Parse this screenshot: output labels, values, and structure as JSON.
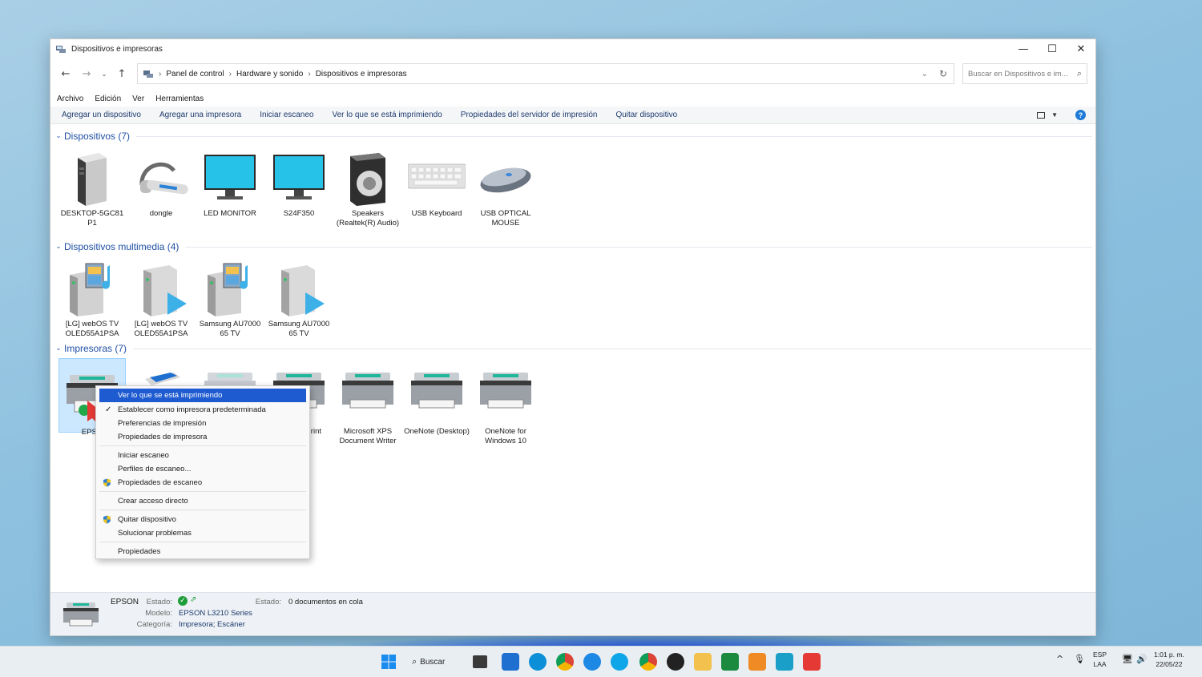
{
  "window": {
    "title": "Dispositivos e impresoras",
    "minimize": "—",
    "maximize": "☐",
    "close": "✕"
  },
  "address": {
    "crumbs": [
      "Panel de control",
      "Hardware y sonido",
      "Dispositivos e impresoras"
    ],
    "search_placeholder": "Buscar en Dispositivos e im..."
  },
  "menubar": [
    "Archivo",
    "Edición",
    "Ver",
    "Herramientas"
  ],
  "commands": [
    "Agregar un dispositivo",
    "Agregar una impresora",
    "Iniciar escaneo",
    "Ver lo que se está imprimiendo",
    "Propiedades del servidor de impresión",
    "Quitar dispositivo"
  ],
  "sections": {
    "devices": {
      "title": "Dispositivos (7)",
      "items": [
        {
          "label": "DESKTOP-5GC81 P1",
          "icon": "computer-tower-icon"
        },
        {
          "label": "dongle",
          "icon": "headset-icon"
        },
        {
          "label": "LED MONITOR",
          "icon": "monitor-icon"
        },
        {
          "label": "S24F350",
          "icon": "monitor-icon"
        },
        {
          "label": "Speakers (Realtek(R) Audio)",
          "icon": "speaker-icon"
        },
        {
          "label": "USB Keyboard",
          "icon": "keyboard-icon"
        },
        {
          "label": "USB OPTICAL MOUSE",
          "icon": "mouse-icon"
        }
      ]
    },
    "multimedia": {
      "title": "Dispositivos multimedia (4)",
      "items": [
        {
          "label": "[LG] webOS TV OLED55A1PSA",
          "icon": "media-server-icon"
        },
        {
          "label": "[LG] webOS TV OLED55A1PSA",
          "icon": "media-renderer-icon"
        },
        {
          "label": "Samsung AU7000 65 TV",
          "icon": "media-server-icon"
        },
        {
          "label": "Samsung AU7000 65 TV",
          "icon": "media-renderer-icon"
        }
      ]
    },
    "printers": {
      "title": "Impresoras (7)",
      "items": [
        {
          "label": "EPSO",
          "icon": "printer-icon"
        },
        {
          "label": "",
          "icon": "fax-icon"
        },
        {
          "label": "",
          "icon": "printer-icon"
        },
        {
          "label": "rint",
          "icon": "printer-icon"
        },
        {
          "label": "Microsoft XPS Document Writer",
          "icon": "printer-icon"
        },
        {
          "label": "OneNote (Desktop)",
          "icon": "printer-icon"
        },
        {
          "label": "OneNote for Windows 10",
          "icon": "printer-icon"
        }
      ]
    }
  },
  "context_menu": [
    "Ver lo que se está imprimiendo",
    "Establecer como impresora predeterminada",
    "Preferencias de impresión",
    "Propiedades de impresora",
    "Iniciar escaneo",
    "Perfiles de escaneo...",
    "Propiedades de escaneo",
    "Crear acceso directo",
    "Quitar dispositivo",
    "Solucionar problemas",
    "Propiedades"
  ],
  "details": {
    "name": "EPSON",
    "estado_label": "Estado:",
    "modelo_label": "Modelo:",
    "modelo_value": "EPSON L3210 Series",
    "categoria_label": "Categoría:",
    "categoria_value": "Impresora; Escáner",
    "estado2_label": "Estado:",
    "estado2_value": "0 documentos en cola"
  },
  "taskbar": {
    "search_label": "Buscar",
    "lang_top": "ESP",
    "lang_bottom": "LAA",
    "time": "1:01 p. m.",
    "date": "22/05/22"
  },
  "colors": {
    "accent": "#1e5bd0",
    "link": "#1d3b6e",
    "section": "#1f4fa5",
    "selection": "#cce8ff"
  }
}
